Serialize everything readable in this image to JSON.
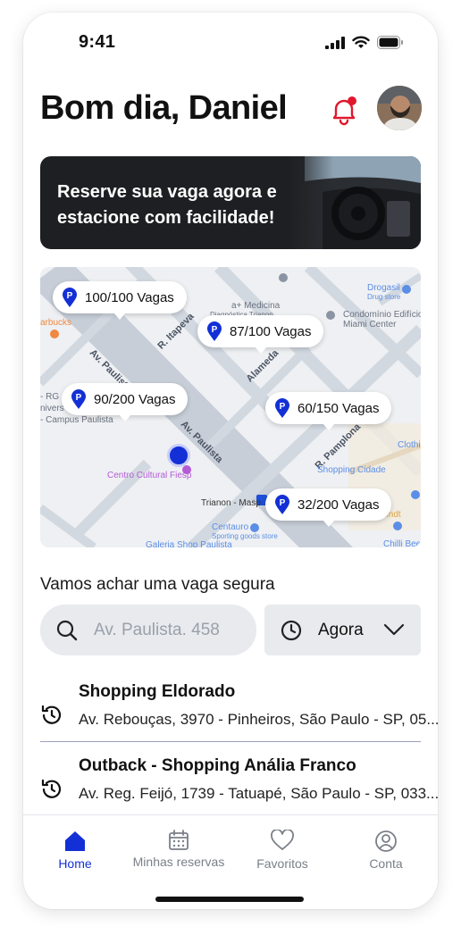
{
  "status_bar": {
    "time": "9:41"
  },
  "header": {
    "greeting": "Bom dia, Daniel"
  },
  "banner": {
    "line1": "Reserve sua vaga agora e",
    "line2": "estacione com facilidade!"
  },
  "map": {
    "pins": [
      {
        "label": "100/100 Vagas"
      },
      {
        "label": "87/100 Vagas"
      },
      {
        "label": "90/200 Vagas"
      },
      {
        "label": "60/150 Vagas"
      },
      {
        "label": "32/200 Vagas"
      }
    ],
    "labels": {
      "drogasil": "Drogasil",
      "drug_store": "Drug store",
      "medicina": "a+ Medicina",
      "diagnostica": "Diagnóstica Trianon",
      "condominio": "Condomínio Edifício",
      "miami": "Miami Center",
      "starbucks": "arbucks",
      "av_paulista_1": "Av. Paulista",
      "av_paulista_2": "Av. Paulista",
      "itapeva": "R. Itapeva",
      "alameda": "Alameda",
      "pamplona": "R. Pamplona",
      "centro_cultural": "Centro Cultural Fiesp",
      "trianon": "Trianon - Masp",
      "shopping_cidade": "Shopping Cidade",
      "centauro": "Centauro",
      "sporting": "Sporting goods store",
      "lindt": "Lindt",
      "chilli": "Chilli Bee",
      "clothing": "Clothin",
      "rg": "- RG",
      "univers": "nivers",
      "campus": "- Campus Paulista",
      "galeria": "Galeria Shop Paulista"
    }
  },
  "search": {
    "title": "Vamos achar uma vaga segura",
    "placeholder": "Av. Paulista. 458",
    "time_label": "Agora"
  },
  "recents": [
    {
      "name": "Shopping Eldorado",
      "address": "Av. Rebouças, 3970 - Pinheiros, São Paulo - SP, 05..."
    },
    {
      "name": "Outback - Shopping Anália Franco",
      "address": "Av. Reg. Feijó, 1739 - Tatuapé, São Paulo - SP, 033..."
    }
  ],
  "tabs": [
    {
      "label": "Home",
      "icon": "home-icon",
      "active": true
    },
    {
      "label": "Minhas reservas",
      "icon": "calendar-icon",
      "active": false
    },
    {
      "label": "Favoritos",
      "icon": "heart-icon",
      "active": false
    },
    {
      "label": "Conta",
      "icon": "user-icon",
      "active": false
    }
  ],
  "colors": {
    "accent": "#1330d6",
    "banner_bg": "#1e1f22",
    "notification_dot": "#e0182d"
  }
}
